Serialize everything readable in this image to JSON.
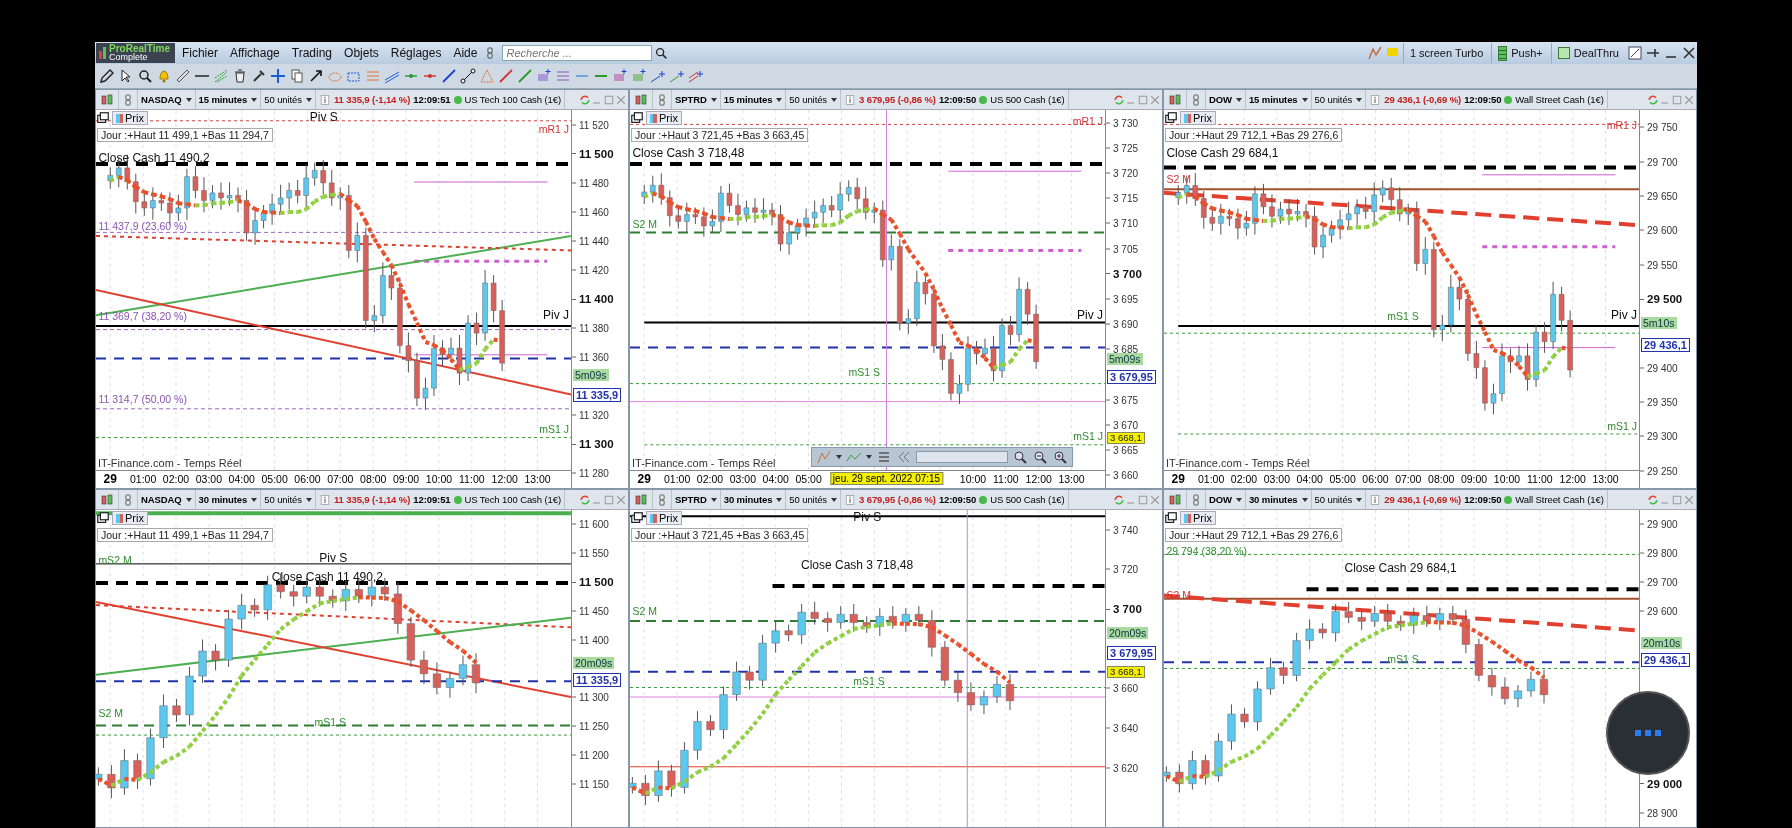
{
  "app": {
    "logo_title": "ProRealTime",
    "logo_subtitle": "Complete",
    "menu": [
      "Fichier",
      "Affichage",
      "Trading",
      "Objets",
      "Réglages",
      "Aide"
    ],
    "search": {
      "placeholder": "Recherche ..."
    },
    "right_buttons": [
      {
        "label": "1 screen Turbo",
        "kind": "plain"
      },
      {
        "label": "Push+",
        "kind": "bars"
      },
      {
        "label": "DealThru",
        "kind": "square"
      }
    ]
  },
  "panels": [
    {
      "header": {
        "symbol": "NASDAQ",
        "interval": "15 minutes",
        "units": "50 unités",
        "quote": "11 335,9 (-1,14 %)",
        "time": "12:09:51",
        "instrument": "US Tech 100 Cash (1€)"
      },
      "tab": "Prix",
      "legend": "Jour :+Haut 11 499,1 +Bas 11 294,7",
      "labels": [
        {
          "text": "Piv S",
          "kind": "pivot"
        },
        {
          "text": "mR1 J",
          "kind": "resistance"
        },
        {
          "text": "Close Cash 11 490,2",
          "kind": "pivot"
        },
        {
          "text": "11 437,9 (23,60 %)",
          "kind": "fib"
        },
        {
          "text": "11 369,7 (38,20 %)",
          "kind": "fib"
        },
        {
          "text": "Piv J",
          "kind": "pivot"
        },
        {
          "text": "11 314,7 (50,00 %)",
          "kind": "fib"
        },
        {
          "text": "mS1 J",
          "kind": "support"
        }
      ],
      "y_ticks": [
        {
          "label": "11 520",
          "major": false
        },
        {
          "label": "11 500",
          "major": true
        },
        {
          "label": "11 480",
          "major": false
        },
        {
          "label": "11 460",
          "major": false
        },
        {
          "label": "11 440",
          "major": false
        },
        {
          "label": "11 420",
          "major": false
        },
        {
          "label": "11 400",
          "major": true
        },
        {
          "label": "11 380",
          "major": false
        },
        {
          "label": "11 360",
          "major": false
        },
        {
          "label": "11 320",
          "major": false
        },
        {
          "label": "11 300",
          "major": true
        },
        {
          "label": "11 280",
          "major": false
        }
      ],
      "price_tags": [
        {
          "text": "5m09s",
          "kind": "timer"
        },
        {
          "text": "11 335,9",
          "kind": "price"
        }
      ],
      "source": "IT-Finance.com - Temps Réel",
      "x_ticks": [
        "29",
        "01:00",
        "02:00",
        "03:00",
        "04:00",
        "05:00",
        "06:00",
        "07:00",
        "08:00",
        "09:00",
        "10:00",
        "11:00",
        "12:00",
        "13:00"
      ]
    },
    {
      "header": {
        "symbol": "SPTRD",
        "interval": "15 minutes",
        "units": "50 unités",
        "quote": "3 679,95 (-0,86 %)",
        "time": "12:09:50",
        "instrument": "US 500 Cash (1€)"
      },
      "tab": "Prix",
      "legend": "Jour :+Haut 3 721,45 +Bas 3 663,45",
      "labels": [
        {
          "text": "mR1 J",
          "kind": "resistance"
        },
        {
          "text": "Close Cash 3 718,48",
          "kind": "pivot"
        },
        {
          "text": "S2 M",
          "kind": "support"
        },
        {
          "text": "Piv J",
          "kind": "pivot"
        },
        {
          "text": "mS1 S",
          "kind": "support"
        },
        {
          "text": "mS1 J",
          "kind": "support"
        }
      ],
      "y_ticks": [
        {
          "label": "3 730",
          "major": false
        },
        {
          "label": "3 725",
          "major": false
        },
        {
          "label": "3 720",
          "major": false
        },
        {
          "label": "3 715",
          "major": false
        },
        {
          "label": "3 710",
          "major": false
        },
        {
          "label": "3 705",
          "major": false
        },
        {
          "label": "3 700",
          "major": true
        },
        {
          "label": "3 695",
          "major": false
        },
        {
          "label": "3 690",
          "major": false
        },
        {
          "label": "3 685",
          "major": false
        },
        {
          "label": "3 675",
          "major": false
        },
        {
          "label": "3 670",
          "major": false
        },
        {
          "label": "3 665",
          "major": false
        },
        {
          "label": "3 660",
          "major": false
        }
      ],
      "price_tags": [
        {
          "text": "5m09s",
          "kind": "timer"
        },
        {
          "text": "3 679,95",
          "kind": "price"
        },
        {
          "text": "3 668,1",
          "kind": "marker"
        }
      ],
      "source": "IT-Finance.com - Temps Réel",
      "x_ticks": [
        "29",
        "01:00",
        "02:00",
        "03:00",
        "04:00",
        "05:00",
        "10:00",
        "11:00",
        "12:00",
        "13:00"
      ],
      "cursor_date": "jeu. 29 sept. 2022 07:15"
    },
    {
      "header": {
        "symbol": "DOW",
        "interval": "15 minutes",
        "units": "50 unités",
        "quote": "29 436,1 (-0,69 %)",
        "time": "12:09:50",
        "instrument": "Wall Street Cash (1€)"
      },
      "tab": "Prix",
      "legend": "Jour :+Haut 29 712,1 +Bas 29 276,6",
      "labels": [
        {
          "text": "mR1 J",
          "kind": "resistance"
        },
        {
          "text": "Close Cash 29 684,1",
          "kind": "pivot"
        },
        {
          "text": "S2 M",
          "kind": "resistance"
        },
        {
          "text": "mS1 S",
          "kind": "support"
        },
        {
          "text": "Piv J",
          "kind": "pivot"
        },
        {
          "text": "mS1 J",
          "kind": "support"
        }
      ],
      "y_ticks": [
        {
          "label": "29 750",
          "major": false
        },
        {
          "label": "29 700",
          "major": false
        },
        {
          "label": "29 650",
          "major": false
        },
        {
          "label": "29 600",
          "major": false
        },
        {
          "label": "29 550",
          "major": false
        },
        {
          "label": "29 500",
          "major": true
        },
        {
          "label": "29 400",
          "major": false
        },
        {
          "label": "29 350",
          "major": false
        },
        {
          "label": "29 300",
          "major": false
        },
        {
          "label": "29 250",
          "major": false
        }
      ],
      "price_tags": [
        {
          "text": "5m10s",
          "kind": "timer"
        },
        {
          "text": "29 436,1",
          "kind": "price"
        }
      ],
      "source": "IT-Finance.com - Temps Réel",
      "x_ticks": [
        "29",
        "01:00",
        "02:00",
        "03:00",
        "04:00",
        "05:00",
        "06:00",
        "07:00",
        "08:00",
        "09:00",
        "10:00",
        "11:00",
        "12:00",
        "13:00"
      ]
    },
    {
      "header": {
        "symbol": "NASDAQ",
        "interval": "30 minutes",
        "units": "50 unités",
        "quote": "11 335,9 (-1,14 %)",
        "time": "12:09:51",
        "instrument": "US Tech 100 Cash (1€)"
      },
      "tab": "Prix",
      "legend": "Jour :+Haut 11 499,1 +Bas 11 294,7",
      "labels": [
        {
          "text": "mS2 M",
          "kind": "support"
        },
        {
          "text": "Piv S",
          "kind": "pivot"
        },
        {
          "text": "Close Cash 11 490,2",
          "kind": "pivot"
        },
        {
          "text": "S2 M",
          "kind": "support"
        },
        {
          "text": "mS1 S",
          "kind": "support"
        }
      ],
      "y_ticks": [
        {
          "label": "11 600",
          "major": false
        },
        {
          "label": "11 550",
          "major": false
        },
        {
          "label": "11 500",
          "major": true
        },
        {
          "label": "11 450",
          "major": false
        },
        {
          "label": "11 400",
          "major": false
        },
        {
          "label": "11 300",
          "major": false
        },
        {
          "label": "11 250",
          "major": false
        },
        {
          "label": "11 200",
          "major": false
        },
        {
          "label": "11 150",
          "major": false
        }
      ],
      "price_tags": [
        {
          "text": "20m09s",
          "kind": "timer"
        },
        {
          "text": "11 335,9",
          "kind": "price"
        }
      ]
    },
    {
      "header": {
        "symbol": "SPTRD",
        "interval": "30 minutes",
        "units": "50 unités",
        "quote": "3 679,95 (-0,86 %)",
        "time": "12:09:50",
        "instrument": "US 500 Cash (1€)"
      },
      "tab": "Prix",
      "legend": "Jour :+Haut 3 721,45 +Bas 3 663,45",
      "labels": [
        {
          "text": "Piv S",
          "kind": "pivot"
        },
        {
          "text": "Close Cash 3 718,48",
          "kind": "pivot"
        },
        {
          "text": "S2 M",
          "kind": "support"
        },
        {
          "text": "mS1 S",
          "kind": "support"
        }
      ],
      "y_ticks": [
        {
          "label": "3 740",
          "major": false
        },
        {
          "label": "3 720",
          "major": false
        },
        {
          "label": "3 700",
          "major": true
        },
        {
          "label": "3 660",
          "major": false
        },
        {
          "label": "3 640",
          "major": false
        },
        {
          "label": "3 620",
          "major": false
        }
      ],
      "price_tags": [
        {
          "text": "20m09s",
          "kind": "timer"
        },
        {
          "text": "3 679,95",
          "kind": "price"
        },
        {
          "text": "3 668,1",
          "kind": "marker"
        }
      ]
    },
    {
      "header": {
        "symbol": "DOW",
        "interval": "30 minutes",
        "units": "50 unités",
        "quote": "29 436,1 (-0,69 %)",
        "time": "12:09:50",
        "instrument": "Wall Street Cash (1€)"
      },
      "tab": "Prix",
      "legend": "Jour :+Haut 29 712,1 +Bas 29 276,6",
      "labels": [
        {
          "text": "29 794 (38,20 %)",
          "kind": "support"
        },
        {
          "text": "Close Cash 29 684,1",
          "kind": "pivot"
        },
        {
          "text": "S2 M",
          "kind": "resistance"
        },
        {
          "text": "mS1 S",
          "kind": "support"
        }
      ],
      "y_ticks": [
        {
          "label": "29 900",
          "major": false
        },
        {
          "label": "29 800",
          "major": false
        },
        {
          "label": "29 700",
          "major": false
        },
        {
          "label": "29 600",
          "major": false
        },
        {
          "label": "29 000",
          "major": true
        },
        {
          "label": "28 900",
          "major": false
        }
      ],
      "price_tags": [
        {
          "text": "20m10s",
          "kind": "timer"
        },
        {
          "text": "29 436,1",
          "kind": "price"
        }
      ]
    }
  ]
}
